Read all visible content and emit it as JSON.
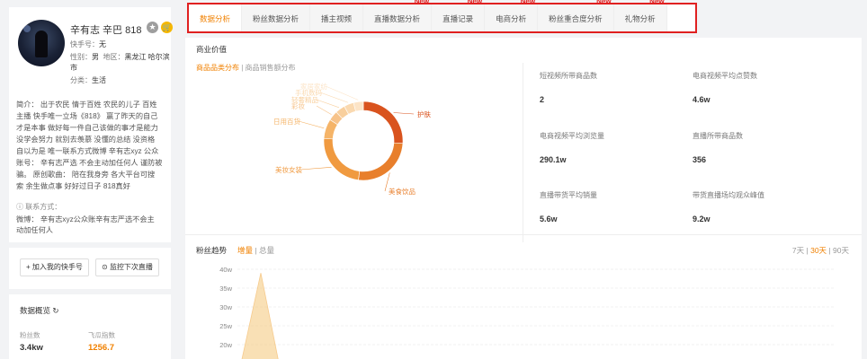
{
  "profile": {
    "name": "辛有志 辛巴 818",
    "icons": {
      "star": "star-icon",
      "cart": "cart-icon"
    },
    "kuaishou_label": "快手号：",
    "kuaishou_value": "无",
    "gender_label": "性别：",
    "gender_value": "男",
    "region_label": "地区：",
    "region_value": "黑龙江 哈尔滨",
    "region_cont": "市",
    "category_label": "分类：",
    "category_value": "生活",
    "bio_lines": [
      "简介： 出于农民 情于百姓 农民的儿子 百姓",
      "主播 快手唯一立场《818》 赢了昨天的自己",
      "才是本事 做好每一件自己该做的事才是能力",
      "没学会努力 就别去羡慕 没懂的总结 没资格",
      "自以为是 唯一联系方式微博 辛有志xyz 公众",
      "账号： 辛有志严选 不会主动加任何人 谨防被",
      "骗。 原创歌曲： 陪在我身旁 各大平台可搜",
      "索 余生做点事 好好过日子 818真好"
    ],
    "contact_title": "联系方式：",
    "contact_lines": [
      "微博： 辛有志xyz公众账辛有志严选不会主",
      "动加任何人"
    ]
  },
  "buttons": {
    "add_kuaishou": "加入我的快手号",
    "monitor_live": "监控下次直播"
  },
  "overview": {
    "title": "数据概览",
    "fans_label": "粉丝数",
    "fans_value": "3.4kw",
    "index_label": "飞瓜指数",
    "index_value": "1256.7"
  },
  "tabs": [
    {
      "label": "数据分析",
      "new": ""
    },
    {
      "label": "粉丝数据分析",
      "new": ""
    },
    {
      "label": "播主视频",
      "new": ""
    },
    {
      "label": "直播数据分析",
      "new": "New"
    },
    {
      "label": "直播记录",
      "new": "New"
    },
    {
      "label": "电商分析",
      "new": "New"
    },
    {
      "label": "粉丝重合度分析",
      "new": "New"
    },
    {
      "label": "礼物分析",
      "new": "New"
    }
  ],
  "commerce": {
    "title": "商业价值",
    "subtab_active": "商品品类分布",
    "subtab_sep": "|",
    "subtab_other": "商品销售额分布"
  },
  "stats": [
    {
      "label": "短视频所带商品数",
      "value": "2"
    },
    {
      "label": "电商视频平均点赞数",
      "value": "4.6w"
    },
    {
      "label": "电商视频平均浏览量",
      "value": "290.1w"
    },
    {
      "label": "直播所带商品数",
      "value": "356"
    },
    {
      "label": "直播带货平均销量",
      "value": "5.6w"
    },
    {
      "label": "带货直播场均观众峰值",
      "value": "9.2w"
    }
  ],
  "trend": {
    "title": "粉丝趋势",
    "tab_active": "增量",
    "tab_sep": "|",
    "tab_other": "总量",
    "range_7": "7天",
    "range_30": "30天",
    "range_90": "90天",
    "range_sep": "|"
  },
  "chart_data": [
    {
      "type": "pie",
      "categories": [
        "护肤",
        "美食饮品",
        "美妆女装",
        "日用百货",
        "彩妆",
        "轻奢精品",
        "手机数码",
        "家居家纺"
      ],
      "values": [
        26,
        26,
        24,
        8,
        4,
        4,
        4,
        4
      ],
      "colors": [
        "#d9531e",
        "#e87f2c",
        "#f09a40",
        "#f5b468",
        "#f7c38a",
        "#f8cf9d",
        "#fad9b0",
        "#fce4c7"
      ]
    },
    {
      "type": "area",
      "title": "粉丝趋势",
      "y_ticks": [
        "40w",
        "35w",
        "30w",
        "25w",
        "20w"
      ],
      "ylim": [
        20,
        40
      ],
      "peak_value": 39,
      "color": "#f5c87a"
    }
  ]
}
